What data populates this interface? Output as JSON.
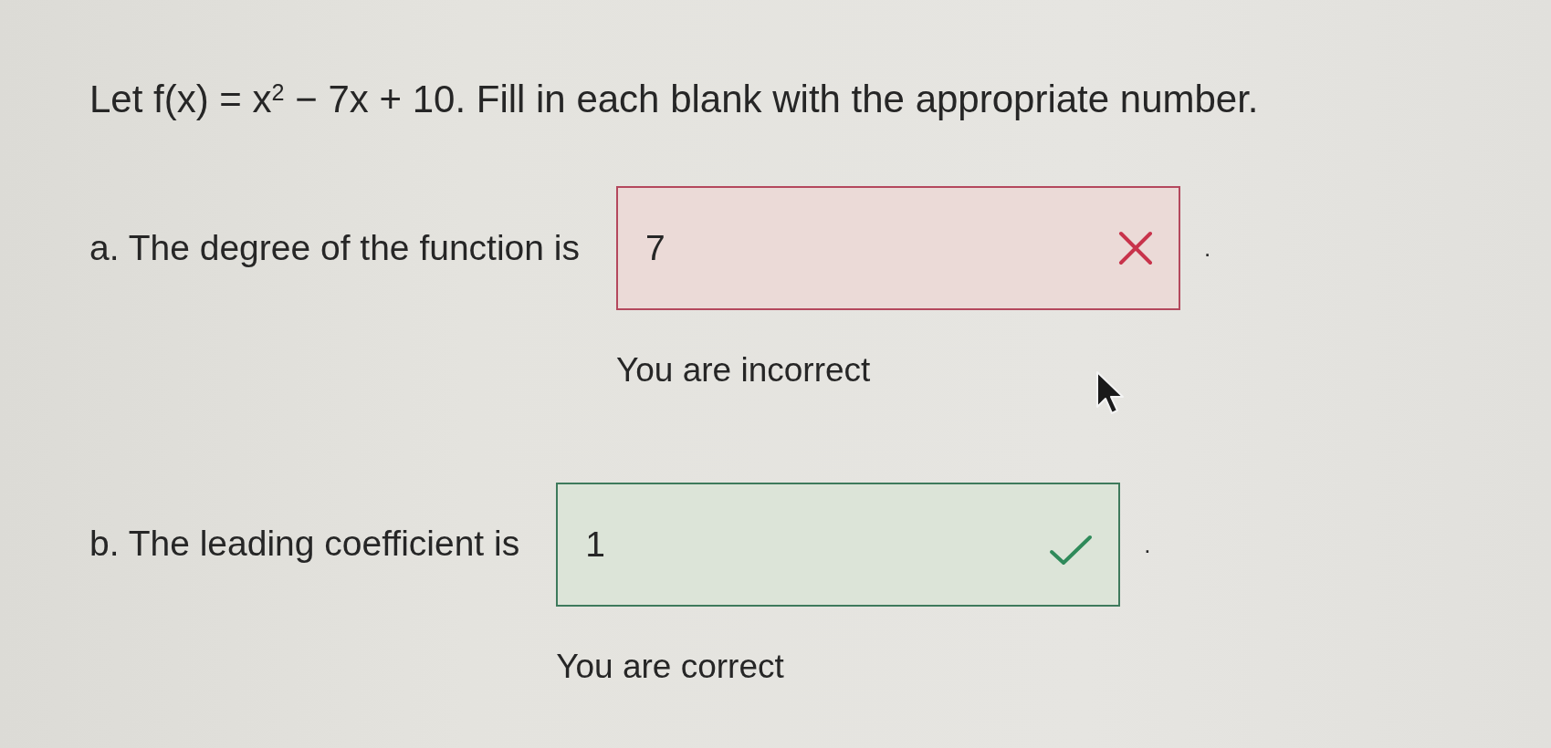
{
  "question": {
    "text": "Let f(x) = x$^{2}$ − 7x + 10. Fill in each blank with the appropriate number."
  },
  "parts": [
    {
      "prompt": "a. The degree of the function is",
      "answer": "7",
      "correct": false,
      "suffix": ".",
      "feedback": "You are incorrect"
    },
    {
      "prompt": "b. The leading coefficient is",
      "answer": "1",
      "correct": true,
      "suffix": ".",
      "feedback": "You are correct"
    }
  ]
}
